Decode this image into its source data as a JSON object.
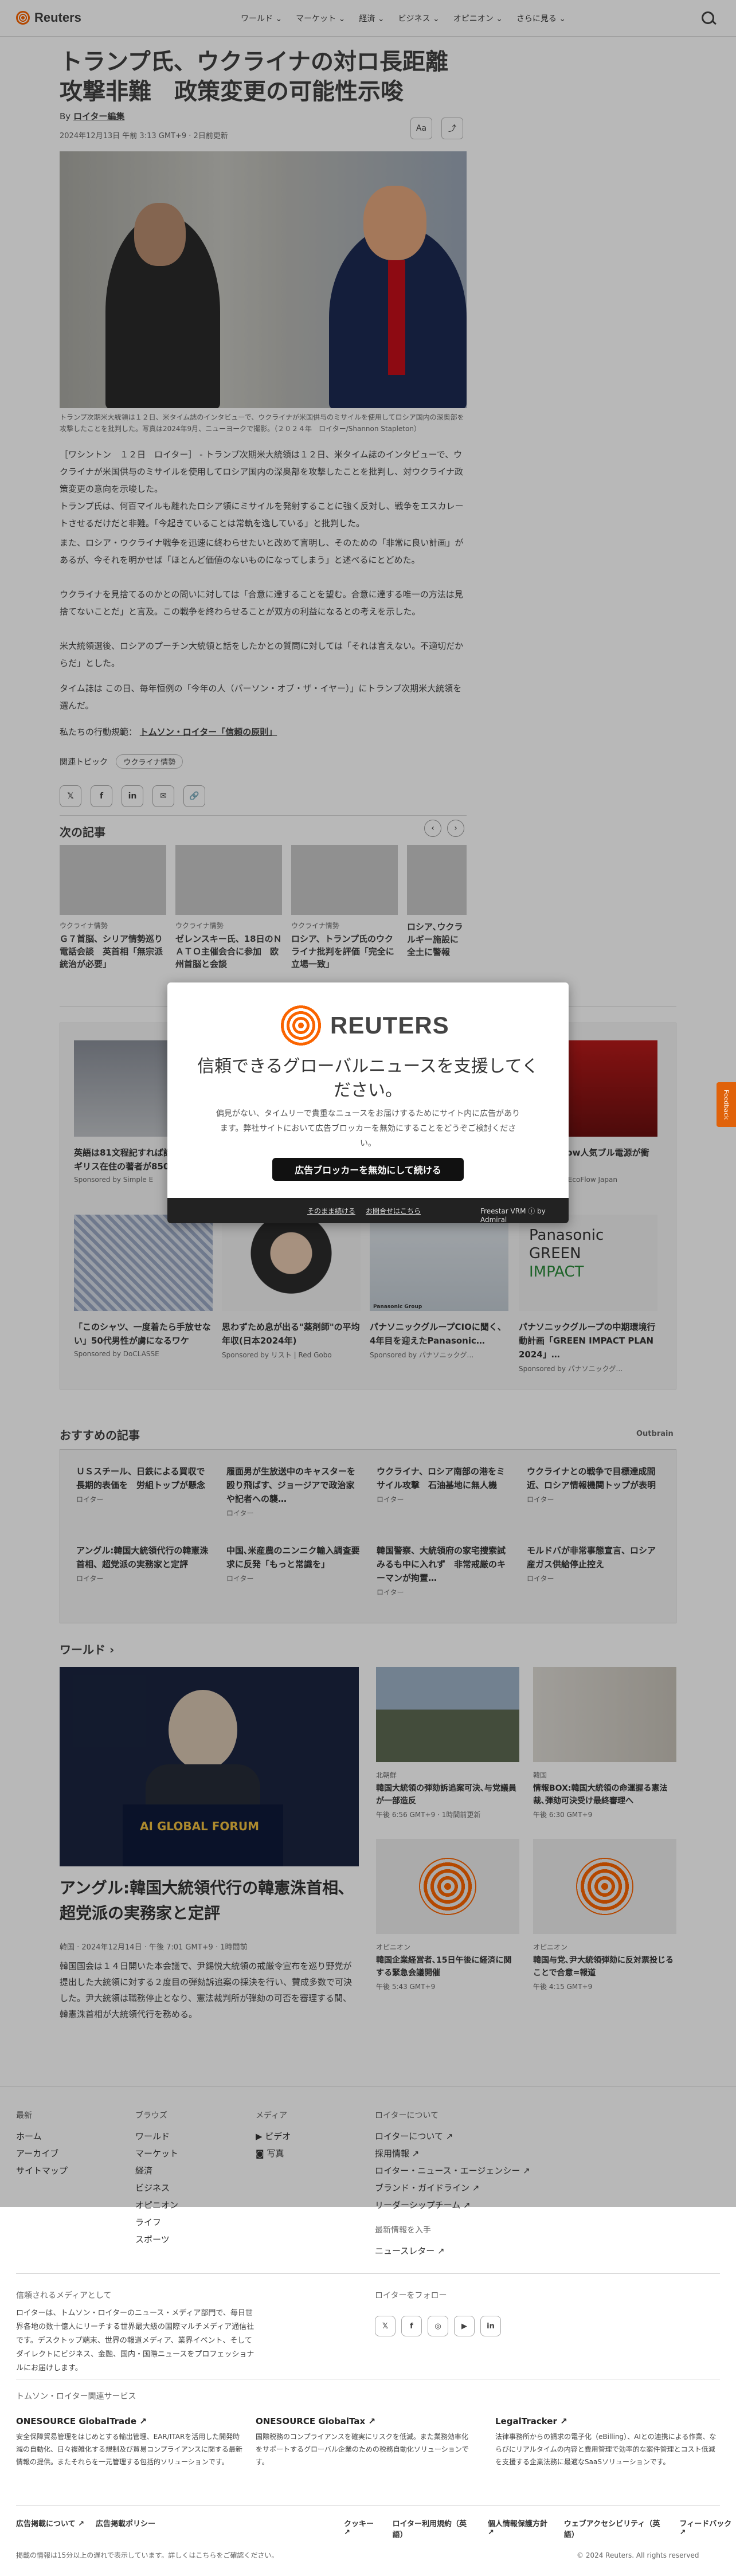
{
  "header": {
    "brand": "Reuters",
    "nav": [
      "ワールド ⌄",
      "マーケット ⌄",
      "経済 ⌄",
      "ビジネス ⌄",
      "オピニオン ⌄",
      "さらに見る ⌄"
    ]
  },
  "article": {
    "title": "トランプ氏、ウクライナの対ロ長距離攻撃非難　政策変更の可能性示唆",
    "by_prefix": "By",
    "author": "ロイター編集",
    "dateline": "2024年12月13日 午前 3:13 GMT+9 · 2日前更新",
    "text_size_label": "Aa",
    "caption": "トランプ次期米大統領は１２日、米タイム誌のインタビューで、ウクライナが米国供与のミサイルを使用してロシア国内の深奥部を攻撃したことを批判した。写真は2024年9月、ニューヨークで撮影。（２０２４年　ロイター/Shannon Stapleton）",
    "paragraphs": [
      "［ワシントン　１２日　ロイター］ - トランプ次期米大統領は１２日、米タイム誌のインタビューで、ウクライナが米国供与のミサイルを使用してロシア国内の深奥部を攻撃したことを批判し、対ウクライナ政策変更の意向を示唆した。",
      "トランプ氏は、何百マイルも離れたロシア領にミサイルを発射することに強く反対し、戦争をエスカレートさせるだけだと非難。「今起きていることは常軌を逸している」と批判した。",
      "また、ロシア・ウクライナ戦争を迅速に終わらせたいと改めて言明し、そのための「非常に良い計画」があるが、今それを明かせば「ほとんど価値のないものになってしまう」と述べるにとどめた。",
      "ウクライナを見捨てるのかとの問いに対しては「合意に達することを望む。合意に達する唯一の方法は見捨てないことだ」と言及。この戦争を終わらせることが双方の利益になるとの考えを示した。",
      "米大統領選後、ロシアのプーチン大統領と話をしたかとの質問に対しては「それは言えない。不適切だからだ」とした。",
      "タイム誌は この日、毎年恒例の「今年の人（パーソン・オブ・ザ・イヤー）」にトランプ次期米大統領を選んだ。"
    ],
    "standards_prefix": "私たちの行動規範：",
    "standards_link": "トムソン・ロイター「信頼の原則」",
    "tags_label": "関連トピック",
    "tag": "ウクライナ情勢",
    "share": [
      "𝕏",
      "f",
      "in",
      "✉",
      "🔗"
    ]
  },
  "next": {
    "heading": "次の記事",
    "cards": [
      {
        "cat": "ウクライナ情勢",
        "title": "Ｇ７首脳、シリア情勢巡り電話会談　英首相「無宗派統治が必要」"
      },
      {
        "cat": "ウクライナ情勢",
        "title": "ゼレンスキー氏、18日のＮＡＴＯ主催会合に参加　欧州首脳と会談"
      },
      {
        "cat": "ウクライナ情勢",
        "title": "ロシア、トランプ氏のウクライナ批判を評価「完全に立場一致」"
      },
      {
        "cat": "",
        "title": "ロシア､ウクラルギー施設に全土に警報"
      }
    ]
  },
  "sponsored": [
    {
      "title": "英語は81文程記すれば話せる?!イギリス在住の著者が850語を発表",
      "src": "Sponsored by Simple E"
    },
    {
      "title": "",
      "src": ""
    },
    {
      "title": "",
      "src": ""
    },
    {
      "title": "OFF EcoFlow人気ブル電源が衝撃",
      "src": "Sponsored by EcoFlow Japan"
    },
    {
      "title": "「このシャツ、一度着たら手放せない」50代男性が虜になるワケ",
      "src": "Sponsored by DoCLASSE"
    },
    {
      "title": "思わずため息が出る\"薬剤師\"の平均年収(日本2024年)",
      "src": "Sponsored by リスト | Red Gobo"
    },
    {
      "title": "パナソニックグループCIOに聞く、4年目を迎えたPanasonic…",
      "src": "Sponsored by パナソニックグ…"
    },
    {
      "title": "パナソニックグループの中期環境行動計画「GREEN IMPACT PLAN 2024」…",
      "src": "Sponsored by パナソニックグ…"
    }
  ],
  "sponsored_brand": {
    "panasonic": "Panasonic",
    "green": "GREEN",
    "impact": "IMPACT",
    "group": "Panasonic Group"
  },
  "recommended": {
    "heading": "おすすめの記事",
    "source": "Outbrain",
    "items": [
      {
        "t": "ＵＳスチール、日鉄による買収で長期的表価を　労組トップが懸念",
        "s": "ロイター"
      },
      {
        "t": "履面男が生放送中のキャスターを殴り飛ばす、ジョージアで政治家や記者への襲…",
        "s": "ロイター"
      },
      {
        "t": "ウクライナ、ロシア南部の港をミサイル攻撃　石油基地に無人機",
        "s": "ロイター"
      },
      {
        "t": "ウクライナとの戦争で目標達成間近、ロシア情報機関トップが表明",
        "s": "ロイター"
      },
      {
        "t": "アングル:韓国大統領代行の韓憲洙首相、超党派の実務家と定評",
        "s": "ロイター"
      },
      {
        "t": "中国､米産農のニンニク輸入調査要求に反発「もっと常識を」",
        "s": "ロイター"
      },
      {
        "t": "韓国警察、大統領府の家宅捜索試みるも中に入れず　非常戒厳のキーマンが拘置…",
        "s": "ロイター"
      },
      {
        "t": "モルドバが非常事態宣言、ロシア産ガス供給停止控え",
        "s": "ロイター"
      }
    ]
  },
  "world": {
    "heading": "ワールド ›",
    "main_title": "アングル:韓国大統領代行の韓憲洙首相､超党派の実務家と定評",
    "main_date": "韓国 · 2024年12月14日 · 午後 7:01 GMT+9 · 1時間前",
    "main_summary": "韓国国会は１４日開いた本会議で、尹錫悦大統領の戒厳令宣布を巡り野党が提出した大統領に対する２度目の弾劾訴追案の採決を行い、賛成多数で可決した。尹大統領は職務停止となり、憲法裁判所が弾劾の可否を審理する間、韓憲洙首相が大統領代行を務める。",
    "forum_banner": "AI GLOBAL FORUM",
    "cards": [
      {
        "cat": "北朝鮮",
        "t": "韓国大統領の弾劾訴追案可決､与党議員が一部造反",
        "d": "午後 6:56 GMT+9 · 1時間前更新"
      },
      {
        "cat": "韓国",
        "t": "情報BOX:韓国大統領の命運握る憲法裁､弾劾可決受け最終審理へ",
        "d": "午後 6:30 GMT+9"
      },
      {
        "cat": "オピニオン",
        "t": "韓国企業経営者､15日午後に経済に関する緊急会議開催",
        "d": "午後 5:43 GMT+9"
      },
      {
        "cat": "オピニオン",
        "t": "韓国与党､尹大統領弾劾に反対票投じることで合意=報道",
        "d": "午後 4:15 GMT+9"
      }
    ]
  },
  "footer": {
    "col1": {
      "h": "最新",
      "items": [
        "ホーム",
        "アーカイブ",
        "サイトマップ"
      ]
    },
    "col2": {
      "h": "ブラウズ",
      "items": [
        "ワールド",
        "マーケット",
        "経済",
        "ビジネス",
        "オピニオン",
        "ライフ",
        "スポーツ"
      ]
    },
    "col3": {
      "h": "メディア",
      "items": [
        "▶ ビデオ",
        "◙ 写真"
      ]
    },
    "col4": {
      "h": "ロイターについて",
      "items": [
        "ロイターについて ↗",
        "採用情報 ↗",
        "ロイター・ニュース・エージェンシー ↗",
        "ブランド・ガイドライン ↗",
        "リーダーシップチーム ↗"
      ]
    },
    "latest_h": "最新情報を入手",
    "newsletter": "ニュースレター ↗",
    "trusted_h": "信頼されるメディアとして",
    "trusted_text": "ロイターは、トムソン・ロイターのニュース・メディア部門で、毎日世界各地の数十億人にリーチする世界最大級の国際マルチメディア通信社です。デスクトップ端末、世界の報道メディア、業界イベント、そしてダイレクトにビジネス、金融、国内・国際ニュースをプロフェッショナルにお届けします。",
    "follow_h": "ロイターをフォロー",
    "social": [
      "𝕏",
      "f",
      "◎",
      "▶",
      "in"
    ],
    "related_h": "トムソン・ロイター関連サービス",
    "services": [
      {
        "name": "ONESOURCE GlobalTrade ↗",
        "desc": "安全保障貿易管理をはじめとする輸出管理、EAR/ITARを活用した開発時減の自動化、日々複雑化する規制及び貿易コンプライアンスに関する最新情報の提供。またそれらを一元管理する包括的ソリューションです。"
      },
      {
        "name": "ONESOURCE GlobalTax ↗",
        "desc": "国際税務のコンプライアンスを確実にリスクを低減。また業務効率化をサポートするグローバル企業のための税務自動化ソリューションです。"
      },
      {
        "name": "LegalTracker ↗",
        "desc": "法律事務所からの請求の電子化（eBilling）、AIとの連携による作業、ならびにリアルタイムの内容と費用管理で効率的な案件管理とコスト低減を支援する企業法務に最適なSaaSソリューションです。"
      }
    ],
    "bottom1": [
      "広告掲載について ↗",
      "広告掲載ポリシー"
    ],
    "bottom2": [
      "クッキー ↗",
      "ロイター利用規約（英語）",
      "個人情報保護方針 ↗",
      "ウェブアクセシビリティ（英語）",
      "フィードバック ↗"
    ],
    "notice": "掲載の情報は15分以上の遅れで表示しています。詳しくはこちらをご確認ください。",
    "copyright": "© 2024 Reuters. All rights reserved"
  },
  "modal": {
    "brand": "REUTERS",
    "title": "信頼できるグローバルニュースを支援してください。",
    "desc": "偏見がない、タイムリーで貴重なニュースをお届けするためにサイト内に広告があります。弊社サイトにおいて広告ブロッカーを無効にすることをどうぞご検討ください。",
    "button": "広告ブロッカーを無効にして続ける",
    "link1": "そのまま続ける",
    "link2": "お問合せはこちら",
    "powered": "Freestar VRM  ⓘ  by Admiral"
  },
  "feedback": "Feedback"
}
